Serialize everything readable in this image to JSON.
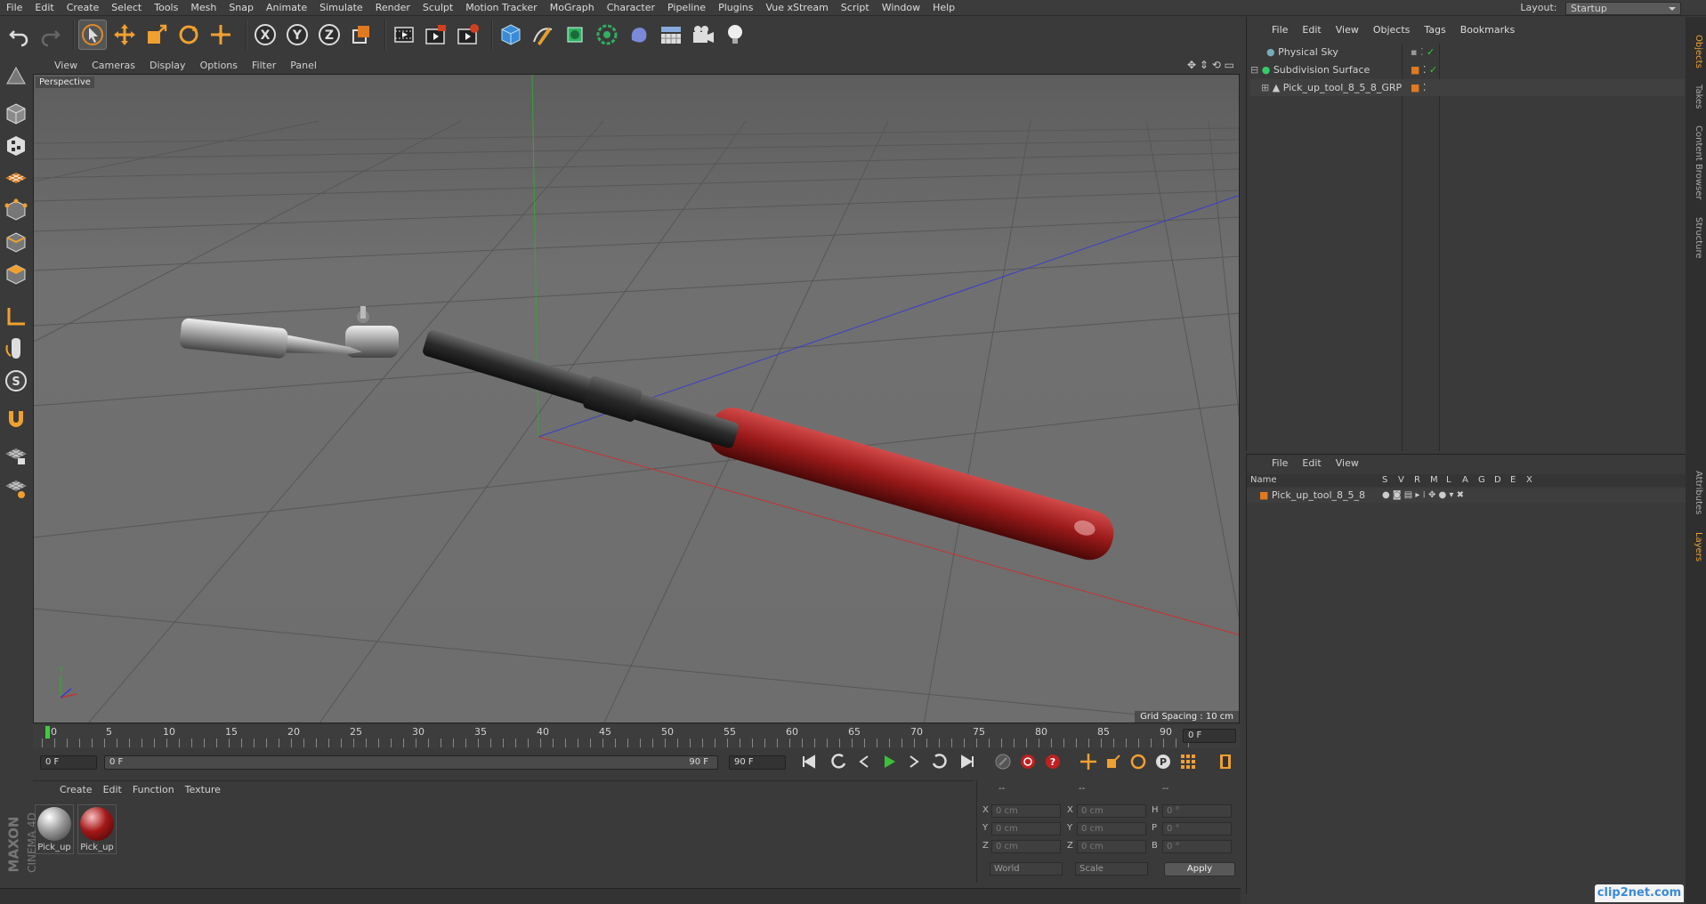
{
  "menubar": {
    "items": [
      "File",
      "Edit",
      "Create",
      "Select",
      "Tools",
      "Mesh",
      "Snap",
      "Animate",
      "Simulate",
      "Render",
      "Sculpt",
      "Motion Tracker",
      "MoGraph",
      "Character",
      "Pipeline",
      "Plugins",
      "Vue xStream",
      "Script",
      "Window",
      "Help"
    ],
    "layout_label": "Layout:",
    "layout_value": "Startup"
  },
  "viewport": {
    "menu": [
      "View",
      "Cameras",
      "Display",
      "Options",
      "Filter",
      "Panel"
    ],
    "camera_label": "Perspective",
    "grid_spacing": "Grid Spacing : 10 cm",
    "colors": {
      "handle": "#9b1a1a",
      "x_axis": "#c83232",
      "y_axis": "#3aa13a",
      "z_axis": "#3c3ccc"
    }
  },
  "timeline": {
    "ticks": [
      "0",
      "5",
      "10",
      "15",
      "20",
      "25",
      "30",
      "35",
      "40",
      "45",
      "50",
      "55",
      "60",
      "65",
      "70",
      "75",
      "80",
      "85",
      "90"
    ],
    "current_frame": "0 F"
  },
  "transport": {
    "start_field": "0 F",
    "range_start": "0 F",
    "range_end": "90 F",
    "end_field": "90 F"
  },
  "materials": {
    "menu": [
      "Create",
      "Edit",
      "Function",
      "Texture"
    ],
    "items": [
      {
        "label": "Pick_up",
        "color": "#a0a0a0"
      },
      {
        "label": "Pick_up",
        "color": "#a31818"
      }
    ]
  },
  "coordinates": {
    "header": [
      "--",
      "--",
      "--"
    ],
    "rows": [
      {
        "a": "X",
        "av": "0 cm",
        "b": "X",
        "bv": "0 cm",
        "c": "H",
        "cv": "0 °"
      },
      {
        "a": "Y",
        "av": "0 cm",
        "b": "Y",
        "bv": "0 cm",
        "c": "P",
        "cv": "0 °"
      },
      {
        "a": "Z",
        "av": "0 cm",
        "b": "Z",
        "bv": "0 cm",
        "c": "B",
        "cv": "0 °"
      }
    ],
    "world_select": "World",
    "scale_select": "Scale",
    "apply_label": "Apply"
  },
  "objects": {
    "menu": [
      "File",
      "Edit",
      "View",
      "Objects",
      "Tags",
      "Bookmarks"
    ],
    "items": [
      {
        "name": "Physical Sky",
        "indent": 1
      },
      {
        "name": "Subdivision Surface",
        "indent": 1
      },
      {
        "name": "Pick_up_tool_8_5_8_GRP",
        "indent": 2
      }
    ]
  },
  "layers": {
    "menu": [
      "File",
      "Edit",
      "View"
    ],
    "columns": [
      "Name",
      "S",
      "V",
      "R",
      "M",
      "L",
      "A",
      "G",
      "D",
      "E",
      "X"
    ],
    "row_name": "Pick_up_tool_8_5_8"
  },
  "right_tabs": [
    "Objects",
    "Takes",
    "Content Browser",
    "Structure",
    "Attributes",
    "Layers"
  ],
  "brand": {
    "maxon": "MAXON",
    "cinema": "CINEMA 4D"
  },
  "watermark": "clip2net.com"
}
